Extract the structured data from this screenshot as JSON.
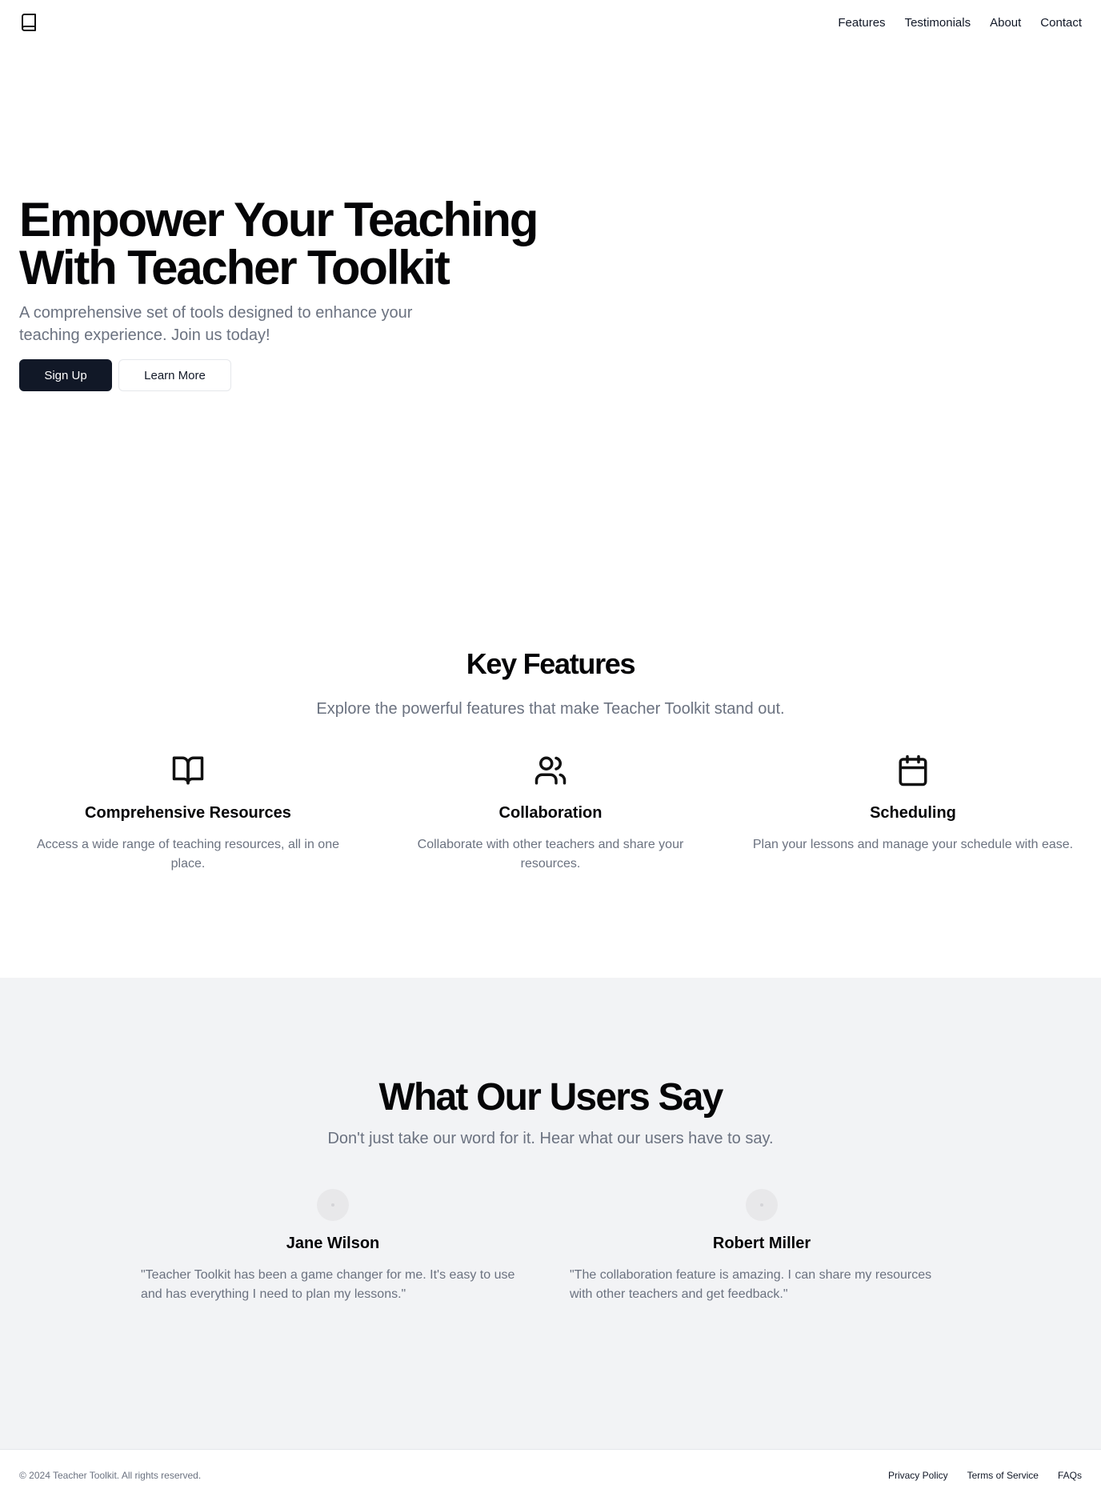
{
  "header": {
    "logo_icon": "book-icon",
    "nav": [
      "Features",
      "Testimonials",
      "About",
      "Contact"
    ]
  },
  "hero": {
    "title_line1": "Empower Your Teaching",
    "title_line2": "With Teacher Toolkit",
    "subtitle": "A comprehensive set of tools designed to enhance your teaching experience. Join us today!",
    "primary_button": "Sign Up",
    "secondary_button": "Learn More"
  },
  "features": {
    "title": "Key Features",
    "subtitle": "Explore the powerful features that make Teacher Toolkit stand out.",
    "items": [
      {
        "icon": "book-open-icon",
        "title": "Comprehensive Resources",
        "description": "Access a wide range of teaching resources, all in one place."
      },
      {
        "icon": "users-icon",
        "title": "Collaboration",
        "description": "Collaborate with other teachers and share your resources."
      },
      {
        "icon": "calendar-icon",
        "title": "Scheduling",
        "description": "Plan your lessons and manage your schedule with ease."
      }
    ]
  },
  "testimonials": {
    "title": "What Our Users Say",
    "subtitle": "Don't just take our word for it. Hear what our users have to say.",
    "items": [
      {
        "name": "Jane Wilson",
        "quote": "\"Teacher Toolkit has been a game changer for me. It's easy to use and has everything I need to plan my lessons.\""
      },
      {
        "name": "Robert Miller",
        "quote": "\"The collaboration feature is amazing. I can share my resources with other teachers and get feedback.\""
      }
    ]
  },
  "footer": {
    "copyright": "© 2024 Teacher Toolkit. All rights reserved.",
    "links": [
      "Privacy Policy",
      "Terms of Service",
      "FAQs"
    ]
  },
  "colors": {
    "primary_button_bg": "#111827",
    "muted_text": "#6b7280",
    "section_bg": "#f2f3f5"
  }
}
